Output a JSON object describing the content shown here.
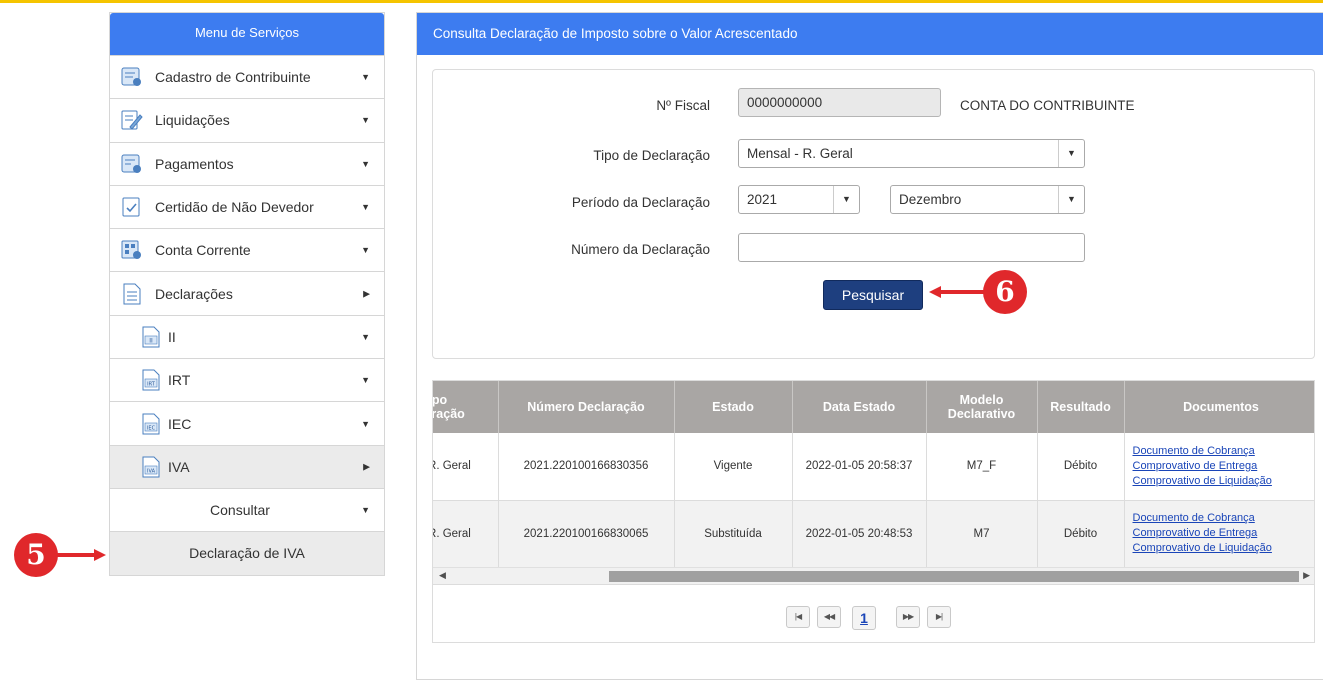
{
  "sidebar": {
    "title": "Menu de Serviços",
    "items": [
      {
        "label": "Cadastro de Contribuinte",
        "icon": "registry-icon"
      },
      {
        "label": "Liquidações",
        "icon": "edit-document-icon"
      },
      {
        "label": "Pagamentos",
        "icon": "payments-icon"
      },
      {
        "label": "Certidão de Não Devedor",
        "icon": "certificate-icon"
      },
      {
        "label": "Conta Corrente",
        "icon": "account-icon"
      },
      {
        "label": "Declarações",
        "icon": "declarations-icon"
      }
    ],
    "sub_items": [
      {
        "label": "II",
        "icon_text": "II"
      },
      {
        "label": "IRT",
        "icon_text": "IRT"
      },
      {
        "label": "IEC",
        "icon_text": "IEC"
      },
      {
        "label": "IVA",
        "icon_text": "IVA"
      }
    ],
    "consultar": "Consultar",
    "declaracao_iva": "Declaração de IVA"
  },
  "main": {
    "title": "Consulta Declaração de Imposto sobre o Valor Acrescentado",
    "form": {
      "nif_label": "Nº Fiscal",
      "nif_value": "0000000000",
      "contribuinte": "CONTA DO CONTRIBUINTE",
      "tipo_label": "Tipo de Declaração",
      "tipo_value": "Mensal - R. Geral",
      "periodo_label": "Período da Declaração",
      "ano_value": "2021",
      "mes_value": "Dezembro",
      "numero_label": "Número da Declaração",
      "numero_value": "",
      "search_button": "Pesquisar"
    },
    "table": {
      "headers": [
        "Tipo\nDeclaração",
        "Número Declaração",
        "Estado",
        "Data Estado",
        "Modelo\nDeclarativo",
        "Resultado",
        "Documentos"
      ],
      "header_tipo_visible": "Tipo\nlaração",
      "rows": [
        {
          "tipo": "- R. Geral",
          "numero": "2021.220100166830356",
          "estado": "Vigente",
          "data": "2022-01-05 20:58:37",
          "modelo": "M7_F",
          "resultado": "Débito",
          "docs": [
            "Documento de Cobrança",
            "Comprovativo de Entrega",
            "Comprovativo de Liquidação"
          ]
        },
        {
          "tipo": "- R. Geral",
          "numero": "2021.220100166830065",
          "estado": "Substituída",
          "data": "2022-01-05 20:48:53",
          "modelo": "M7",
          "resultado": "Débito",
          "docs": [
            "Documento de Cobrança",
            "Comprovativo de Entrega",
            "Comprovativo de Liquidação"
          ]
        }
      ]
    },
    "pager": {
      "current_page": "1"
    }
  },
  "annotations": {
    "step5": "5",
    "step6": "6",
    "color": "#e0282b"
  },
  "colors": {
    "header_blue": "#3d7cf0",
    "button_navy": "#1e3f7f",
    "table_header": "#a9a6a4",
    "top_bar": "#f5c400"
  }
}
